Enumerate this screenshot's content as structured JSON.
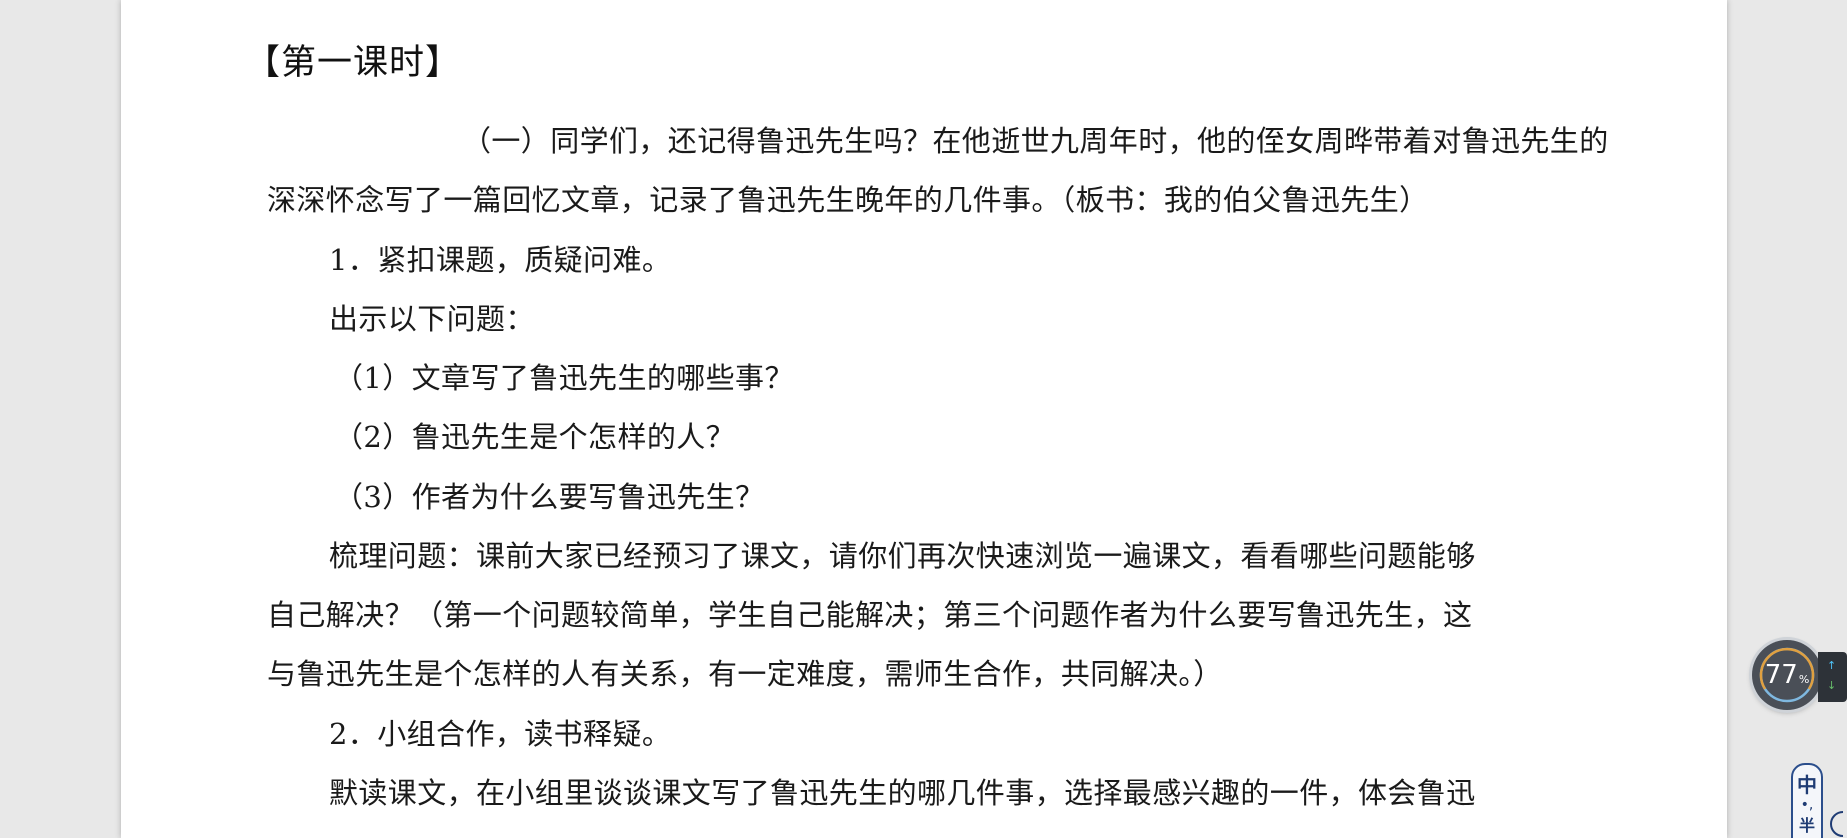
{
  "document": {
    "heading": "【第一课时】",
    "lines": [
      "（一）同学们，还记得鲁迅先生吗？在他逝世九周年时，他的侄女周晔带着对鲁迅先生的",
      "深深怀念写了一篇回忆文章，记录了鲁迅先生晚年的几件事。（板书：我的伯父鲁迅先生）",
      "1．紧扣课题，质疑问难。",
      "出示以下问题：",
      "（1）文章写了鲁迅先生的哪些事？",
      "（2）鲁迅先生是个怎样的人？",
      "（3）作者为什么要写鲁迅先生？",
      "梳理问题：课前大家已经预习了课文，请你们再次快速浏览一遍课文，看看哪些问题能够",
      "自己解决？（第一个问题较简单，学生自己能解决；第三个问题作者为什么要写鲁迅先生，这",
      "与鲁迅先生是个怎样的人有关系，有一定难度，需师生合作，共同解决。）",
      "2．小组合作，读书释疑。",
      "默读课文，在小组里谈谈课文写了鲁迅先生的哪几件事，选择最感兴趣的一件，体会鲁迅"
    ]
  },
  "speed_widget": {
    "value": "77",
    "unit": "%",
    "up_arrow": "↑",
    "down_arrow": "↓",
    "ring_color": "#e0a040",
    "ring_track_color": "#7fb8e0"
  },
  "ime_widget": {
    "mode": "中",
    "punct": "•,",
    "width_mode": "半"
  },
  "colors": {
    "page_background": "#ffffff",
    "desktop_background": "#e8e8e8",
    "text": "#1a1a1a"
  }
}
